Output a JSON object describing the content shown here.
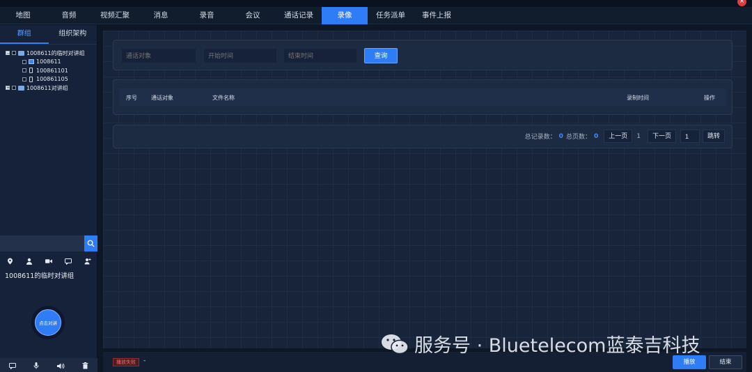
{
  "window": {
    "close_icon": "close-icon"
  },
  "topnav": [
    {
      "label": "地图",
      "active": false
    },
    {
      "label": "音频",
      "active": false
    },
    {
      "label": "视频汇聚",
      "active": false
    },
    {
      "label": "消息",
      "active": false
    },
    {
      "label": "录音",
      "active": false
    },
    {
      "label": "会议",
      "active": false
    },
    {
      "label": "通话记录",
      "active": false
    },
    {
      "label": "录像",
      "active": true
    },
    {
      "label": "任务派单",
      "active": false
    },
    {
      "label": "事件上报",
      "active": false
    }
  ],
  "sidebar": {
    "tabs": [
      {
        "label": "群组",
        "active": true
      },
      {
        "label": "组织架构",
        "active": false
      }
    ],
    "tree": [
      {
        "label": "1008611的临时对讲组",
        "type": "group",
        "expanded": true
      },
      {
        "label": "1008611",
        "type": "pc"
      },
      {
        "label": "100861101",
        "type": "phone"
      },
      {
        "label": "100861105",
        "type": "phone"
      },
      {
        "label": "1008611对讲组",
        "type": "group",
        "expanded": false
      }
    ],
    "search_placeholder": "",
    "current_group": "1008611的临时对讲组",
    "ptt_label": "点击对讲",
    "icons": [
      "location-icon",
      "person-icon",
      "video-icon",
      "message-icon",
      "user-add-icon"
    ],
    "bottom_icons": [
      "chat-icon",
      "mic-icon",
      "speaker-icon",
      "trash-icon"
    ]
  },
  "filter": {
    "target_placeholder": "通话对象",
    "start_placeholder": "开始时间",
    "end_placeholder": "结束时间",
    "query_label": "查询"
  },
  "table": {
    "headers": {
      "index": "序号",
      "target": "通话对象",
      "filename": "文件名称",
      "time": "录制时间",
      "action": "操作"
    },
    "rows": []
  },
  "pager": {
    "total_records_label": "总记录数：",
    "total_records": "0",
    "total_pages_label": "总页数：",
    "total_pages": "0",
    "prev_label": "上一页",
    "current_page": "1",
    "next_label": "下一页",
    "jump_value": "1",
    "jump_label": "跳转"
  },
  "footer": {
    "status": "播放失败",
    "dash": "-",
    "play_label": "播放",
    "end_label": "结束"
  },
  "watermark": {
    "text": "服务号 · Bluetelecom蓝泰吉科技"
  },
  "colors": {
    "accent": "#2e7cf6",
    "bg": "#0d1726",
    "panel": "#1c2a42",
    "error": "#ff6b6b"
  }
}
